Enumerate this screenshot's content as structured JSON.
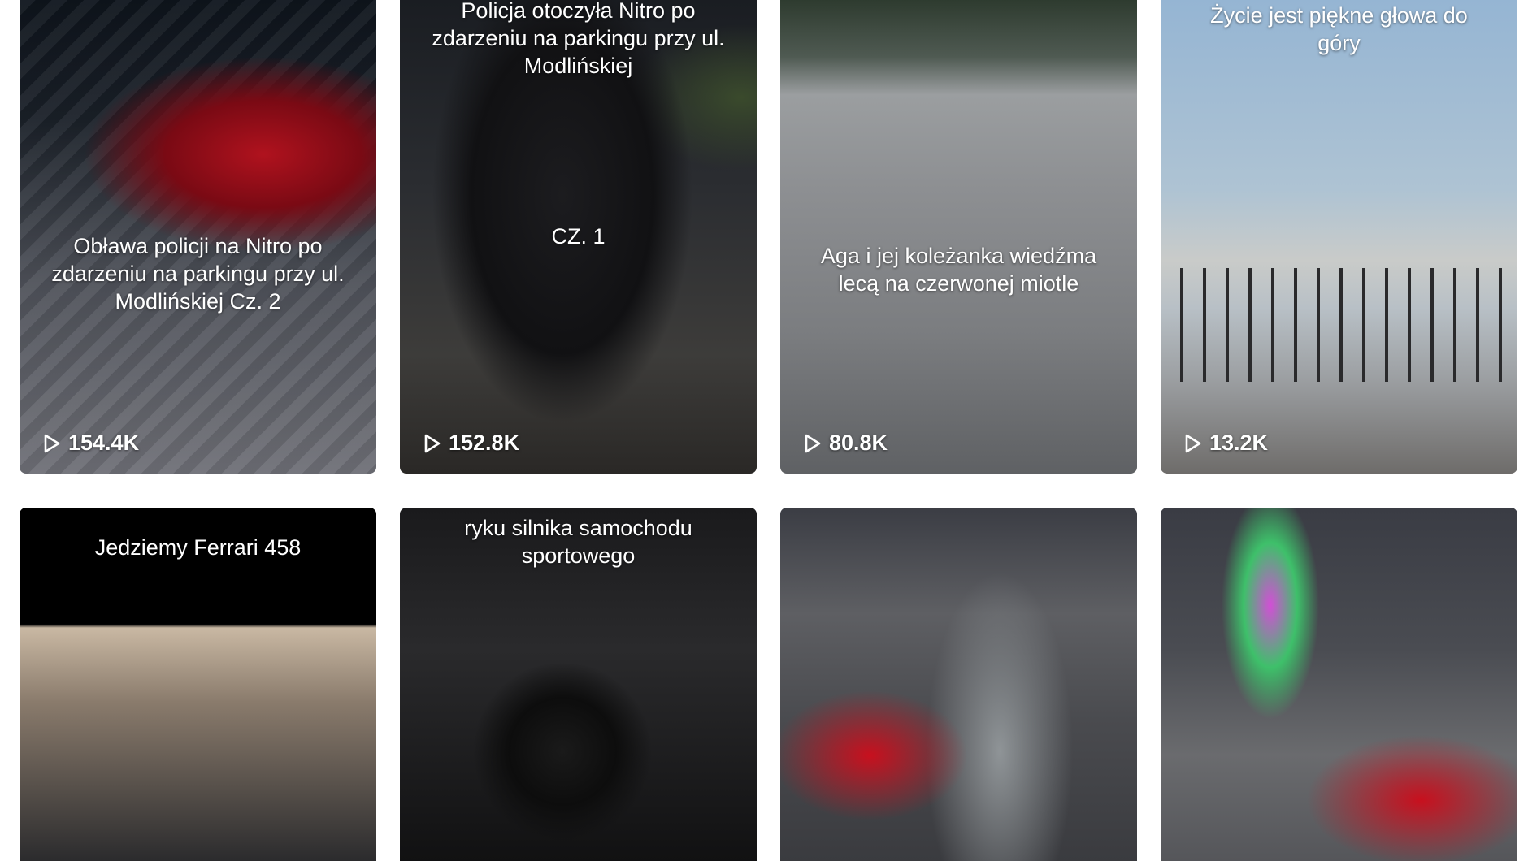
{
  "videos": [
    {
      "caption": "Obława policji na Nitro po\nzdarzeniu na parkingu przy ul.\nModlińskiej Cz. 2",
      "views": "154.4K"
    },
    {
      "caption": "Policja otoczyła Nitro po\nzdarzeniu na parkingu przy ul.\nModlińskiej",
      "caption2": "CZ. 1",
      "views": "152.8K"
    },
    {
      "caption": "Aga i jej koleżanka wiedźma\nlecą na czerwonej miotle",
      "views": "80.8K"
    },
    {
      "caption": "Życie jest piękne głowa do\ngóry",
      "views": "13.2K"
    },
    {
      "caption": "Jedziemy Ferrari 458"
    },
    {
      "caption": "ryku silnika samochodu\nsportowego"
    },
    {
      "caption": ""
    },
    {
      "caption": ""
    }
  ],
  "icons": {
    "views": "play-icon"
  }
}
